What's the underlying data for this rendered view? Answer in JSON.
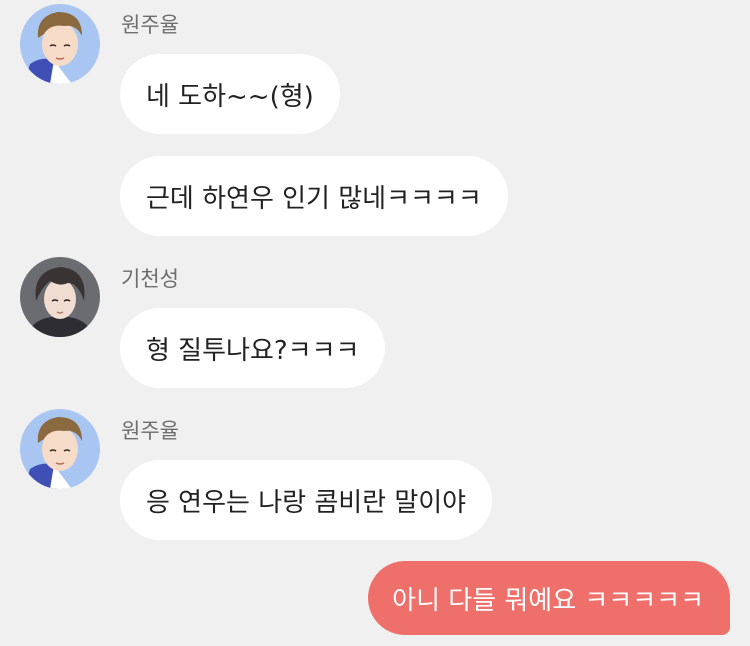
{
  "colors": {
    "background": "#f0f0f0",
    "incoming_bubble": "#ffffff",
    "outgoing_bubble": "#ef6f6b",
    "sender_name": "#6e6e6e"
  },
  "messages": [
    {
      "sender": "원주율",
      "avatar": "blue-haired-avatar-icon",
      "text": "네 도하~~(형)"
    },
    {
      "sender": "원주율",
      "text": "근데 하연우 인기 많네ㅋㅋㅋㅋ"
    },
    {
      "sender": "기천성",
      "avatar": "dark-haired-avatar-icon",
      "text": "형 질투나요?ㅋㅋㅋ"
    },
    {
      "sender": "원주율",
      "avatar": "blue-haired-avatar-icon",
      "text": "응 연우는 나랑 콤비란 말이야"
    },
    {
      "sender": "me",
      "text": "아니 다들 뭐예요 ㅋㅋㅋㅋㅋ"
    }
  ]
}
